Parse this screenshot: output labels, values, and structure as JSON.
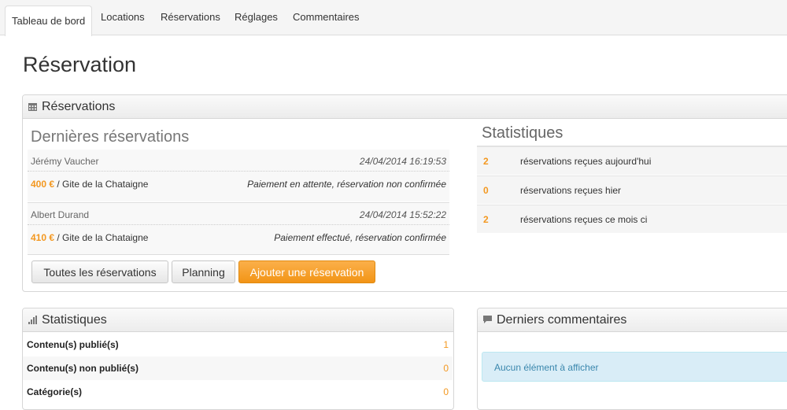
{
  "tabs": [
    {
      "label": "Tableau de bord"
    },
    {
      "label": "Locations"
    },
    {
      "label": "Réservations"
    },
    {
      "label": "Réglages"
    },
    {
      "label": "Commentaires"
    }
  ],
  "page_title": "Réservation",
  "reservations_panel": {
    "title": "Réservations",
    "icon": "calendar-icon",
    "latest_title": "Dernières réservations",
    "items": [
      {
        "name": "Jérémy Vaucher",
        "date": "24/04/2014 16:19:53",
        "amount": "400 €",
        "place": " / Gite de la Chataigne",
        "status": "Paiement en attente, réservation non confirmée"
      },
      {
        "name": "Albert Durand",
        "date": "24/04/2014 15:52:22",
        "amount": "410 €",
        "place": " / Gite de la Chataigne",
        "status": "Paiement effectué, réservation confirmée"
      }
    ],
    "buttons": {
      "all": "Toutes les réservations",
      "planning": "Planning",
      "add": "Ajouter une réservation"
    },
    "stats_title": "Statistiques",
    "stats": [
      {
        "count": "2",
        "label": "réservations reçues aujourd'hui"
      },
      {
        "count": "0",
        "label": "réservations reçues hier"
      },
      {
        "count": "2",
        "label": "réservations reçues ce mois ci"
      }
    ]
  },
  "stats_panel": {
    "title": "Statistiques",
    "icon": "bar-chart-icon",
    "rows": [
      {
        "key": "Contenu(s) publié(s)",
        "value": "1"
      },
      {
        "key": "Contenu(s) non publié(s)",
        "value": "0"
      },
      {
        "key": "Catégorie(s)",
        "value": "0"
      }
    ]
  },
  "comments_panel": {
    "title": "Derniers commentaires",
    "icon": "comment-icon",
    "empty": "Aucun élément à afficher"
  },
  "colors": {
    "accent": "#f39820",
    "info_bg": "#d9edf7",
    "info_text": "#3a87ad"
  }
}
